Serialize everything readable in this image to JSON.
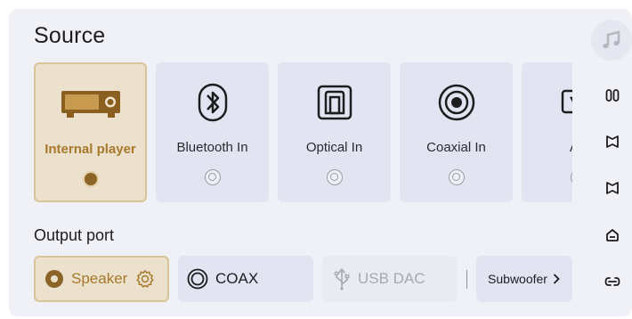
{
  "source": {
    "title": "Source",
    "cards": [
      {
        "label": "Internal player",
        "icon": "player-device-icon",
        "selected": true
      },
      {
        "label": "Bluetooth In",
        "icon": "bluetooth-icon",
        "selected": false
      },
      {
        "label": "Optical In",
        "icon": "optical-icon",
        "selected": false
      },
      {
        "label": "Coaxial In",
        "icon": "coaxial-icon",
        "selected": false
      },
      {
        "label": "AF",
        "icon": "arc-icon",
        "selected": false
      }
    ]
  },
  "output": {
    "title": "Output port",
    "ports": {
      "speaker": "Speaker",
      "coax": "COAX",
      "usb_dac": "USB DAC",
      "subwoofer": "Subwoofer"
    }
  },
  "colors": {
    "accent": "#a8792b",
    "selected_bg": "#ebe1cd",
    "card_bg": "#e2e5f1",
    "panel_bg": "#f0f1f7"
  }
}
